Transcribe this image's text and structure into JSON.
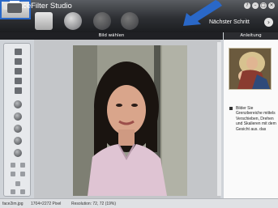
{
  "app": {
    "title": "FaceFilter Studio"
  },
  "toolbar": {
    "next_step_label": "Nächster Schritt",
    "next_step_icon": "chevron-right-icon",
    "buttons": [
      {
        "name": "open-image-button",
        "icon": "folder-icon"
      },
      {
        "name": "face-filter-button",
        "icon": "face-icon"
      },
      {
        "name": "face-adjust-button",
        "icon": "face-icon"
      },
      {
        "name": "face-extra-button",
        "icon": "face-icon"
      },
      {
        "name": "print-button",
        "icon": "printer-icon"
      }
    ],
    "window_controls": [
      "?",
      "–",
      "□",
      "×"
    ]
  },
  "section": {
    "title": "Bild wählen"
  },
  "guide": {
    "title": "Anleitung",
    "text": "Bilder Sie Grenzbereiche mittels Verschieben, Drehen und Skalieren mit dem Gesicht aus. das"
  },
  "status": {
    "filename": "face2im.jpg",
    "dimensions": "1704×2272 Pixel",
    "resolution": "Resolution: 72, 72 (19%)"
  },
  "colors": {
    "accent": "#2a68c8",
    "topbar": "#2e3034"
  }
}
